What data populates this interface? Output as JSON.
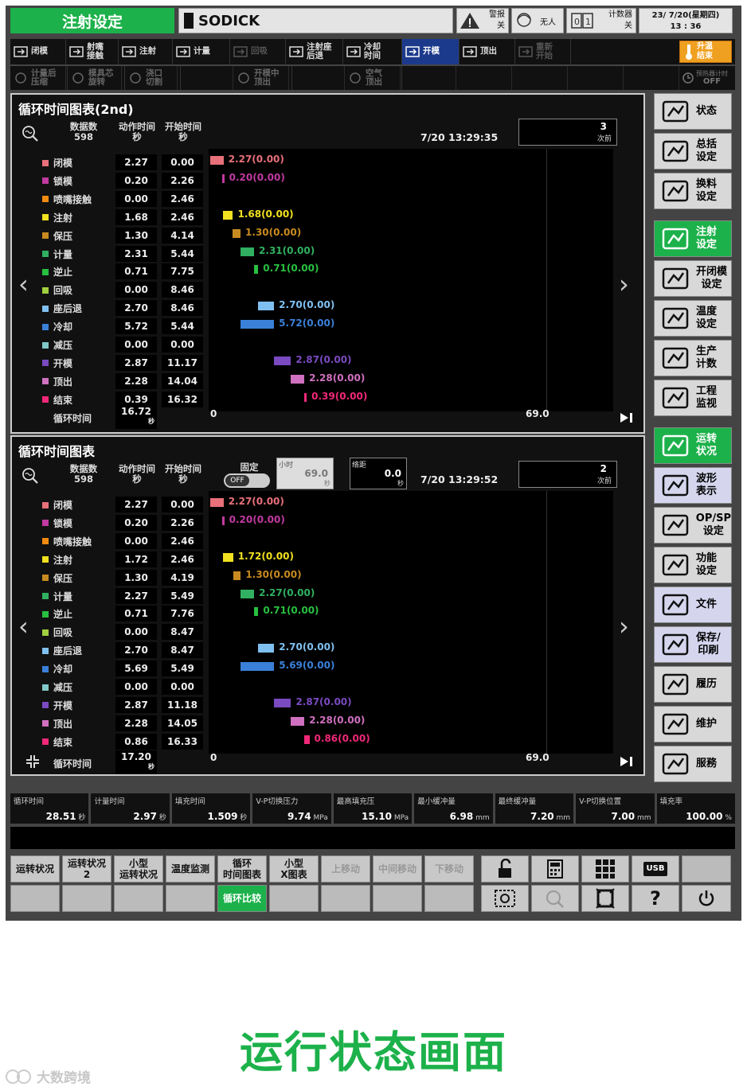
{
  "header": {
    "title": "注射设定",
    "brand": "SODICK",
    "alarm": {
      "l1": "警报",
      "l2": "关"
    },
    "unmanned": "无人",
    "counter": {
      "l1": "计数器",
      "l2": "关"
    },
    "date": "23/ 7/20(星期四)",
    "time": "13 : 36"
  },
  "toolbar1": [
    {
      "label": "闭模",
      "icon": "mold-close-icon",
      "state": "normal"
    },
    {
      "label": "射嘴\n接触",
      "icon": "nozzle-touch-icon",
      "state": "normal"
    },
    {
      "label": "注射",
      "icon": "injection-icon",
      "state": "normal"
    },
    {
      "label": "计量",
      "icon": "metering-icon",
      "state": "normal"
    },
    {
      "label": "回吸",
      "icon": "suckback-icon",
      "state": "dim"
    },
    {
      "label": "注射座\n后退",
      "icon": "carriage-back-icon",
      "state": "normal"
    },
    {
      "label": "冷却\n时间",
      "icon": "cooling-icon",
      "state": "normal"
    },
    {
      "label": "开模",
      "icon": "mold-open-icon",
      "state": "active"
    },
    {
      "label": "顶出",
      "icon": "ejector-icon",
      "state": "normal"
    },
    {
      "label": "重新\n开始",
      "icon": "restart-icon",
      "state": "dim"
    }
  ],
  "heat_button": {
    "l1": "升温",
    "l2": "结束"
  },
  "toolbar2": [
    {
      "label": "计量后\n压缩",
      "icon": "decompress-icon"
    },
    {
      "label": "模具芯\n旋转",
      "icon": "core-rotate-icon"
    },
    {
      "label": "浇口\n切割",
      "icon": "gate-cut-icon"
    },
    {
      "label": "开模中\n顶出",
      "icon": "open-eject-icon"
    },
    {
      "label": "空气\n顶出",
      "icon": "air-eject-icon"
    }
  ],
  "timer_off": {
    "l1": "预热器计时",
    "l2": "OFF"
  },
  "panel1": {
    "title": "循环时间图表(2nd)",
    "count_label": "数据数",
    "count": "598",
    "col1": "动作时间",
    "col2": "开始时间",
    "unit": "秒",
    "timestamp": "7/20 13:29:35",
    "history_num": "3",
    "history_label": "次前",
    "cycle_label": "循环时间",
    "cycle_value": "16.72",
    "axis_start": "0",
    "axis_end": "69.0",
    "rows": [
      {
        "name": "闭模",
        "color": "#e8707a",
        "action": "2.27",
        "start": "0.00",
        "label": "2.27(0.00)"
      },
      {
        "name": "锁模",
        "color": "#c03aa0",
        "action": "0.20",
        "start": "2.26",
        "label": "0.20(0.00)"
      },
      {
        "name": "喷嘴接触",
        "color": "#f08a10",
        "action": "0.00",
        "start": "2.46",
        "label": ""
      },
      {
        "name": "注射",
        "color": "#f0e020",
        "action": "1.68",
        "start": "2.46",
        "label": "1.68(0.00)"
      },
      {
        "name": "保压",
        "color": "#c88a20",
        "action": "1.30",
        "start": "4.14",
        "label": "1.30(0.00)"
      },
      {
        "name": "计量",
        "color": "#30b060",
        "action": "2.31",
        "start": "5.44",
        "label": "2.31(0.00)"
      },
      {
        "name": "逆止",
        "color": "#28c040",
        "action": "0.71",
        "start": "7.75",
        "label": "0.71(0.00)"
      },
      {
        "name": "回吸",
        "color": "#a0d040",
        "action": "0.00",
        "start": "8.46",
        "label": ""
      },
      {
        "name": "座后退",
        "color": "#80c0f0",
        "action": "2.70",
        "start": "8.46",
        "label": "2.70(0.00)"
      },
      {
        "name": "冷却",
        "color": "#3a80d8",
        "action": "5.72",
        "start": "5.44",
        "label": "5.72(0.00)"
      },
      {
        "name": "减压",
        "color": "#80c8c8",
        "action": "0.00",
        "start": "0.00",
        "label": ""
      },
      {
        "name": "开模",
        "color": "#7a4ac0",
        "action": "2.87",
        "start": "11.17",
        "label": "2.87(0.00)"
      },
      {
        "name": "顶出",
        "color": "#d070c0",
        "action": "2.28",
        "start": "14.04",
        "label": "2.28(0.00)"
      },
      {
        "name": "结束",
        "color": "#f02878",
        "action": "0.39",
        "start": "16.32",
        "label": "0.39(0.00)"
      }
    ]
  },
  "panel2": {
    "title": "循环时间图表",
    "count_label": "数据数",
    "count": "598",
    "col1": "动作时间",
    "col2": "开始时间",
    "unit": "秒",
    "fixed_label": "固定",
    "toggle": "OFF",
    "small_label": "小时",
    "small_value": "69.0",
    "pitch_label": "络距",
    "pitch_value": "0.0",
    "timestamp": "7/20 13:29:52",
    "history_num": "2",
    "history_label": "次前",
    "cycle_label": "循环时间",
    "cycle_value": "17.20",
    "axis_start": "0",
    "axis_end": "69.0",
    "rows": [
      {
        "name": "闭模",
        "color": "#e8707a",
        "action": "2.27",
        "start": "0.00",
        "label": "2.27(0.00)"
      },
      {
        "name": "锁模",
        "color": "#c03aa0",
        "action": "0.20",
        "start": "2.26",
        "label": "0.20(0.00)"
      },
      {
        "name": "喷嘴接触",
        "color": "#f08a10",
        "action": "0.00",
        "start": "2.46",
        "label": ""
      },
      {
        "name": "注射",
        "color": "#f0e020",
        "action": "1.72",
        "start": "2.46",
        "label": "1.72(0.00)"
      },
      {
        "name": "保压",
        "color": "#c88a20",
        "action": "1.30",
        "start": "4.19",
        "label": "1.30(0.00)"
      },
      {
        "name": "计量",
        "color": "#30b060",
        "action": "2.27",
        "start": "5.49",
        "label": "2.27(0.00)"
      },
      {
        "name": "逆止",
        "color": "#28c040",
        "action": "0.71",
        "start": "7.76",
        "label": "0.71(0.00)"
      },
      {
        "name": "回吸",
        "color": "#a0d040",
        "action": "0.00",
        "start": "8.47",
        "label": ""
      },
      {
        "name": "座后退",
        "color": "#80c0f0",
        "action": "2.70",
        "start": "8.47",
        "label": "2.70(0.00)"
      },
      {
        "name": "冷却",
        "color": "#3a80d8",
        "action": "5.69",
        "start": "5.49",
        "label": "5.69(0.00)"
      },
      {
        "name": "减压",
        "color": "#80c8c8",
        "action": "0.00",
        "start": "0.00",
        "label": ""
      },
      {
        "name": "开模",
        "color": "#7a4ac0",
        "action": "2.87",
        "start": "11.18",
        "label": "2.87(0.00)"
      },
      {
        "name": "顶出",
        "color": "#d070c0",
        "action": "2.28",
        "start": "14.05",
        "label": "2.28(0.00)"
      },
      {
        "name": "结束",
        "color": "#f02878",
        "action": "0.86",
        "start": "16.33",
        "label": "0.86(0.00)"
      }
    ]
  },
  "sidebar": [
    {
      "label": "状态",
      "icon": "gauge-icon",
      "style": "normal"
    },
    {
      "label": "总括\n设定",
      "icon": "summary-icon",
      "style": "normal"
    },
    {
      "label": "换料\n设定",
      "icon": "material-change-icon",
      "style": "normal"
    },
    {
      "label": "注射\n设定",
      "icon": "injection-setting-icon",
      "style": "green"
    },
    {
      "label": "开闭模\n设定",
      "icon": "mold-setting-icon",
      "style": "normal"
    },
    {
      "label": "温度\n设定",
      "icon": "thermometer-icon",
      "style": "normal"
    },
    {
      "label": "生产\n计数",
      "icon": "production-icon",
      "style": "normal"
    },
    {
      "label": "工程\n监视",
      "icon": "monitor-icon",
      "style": "normal"
    },
    {
      "label": "运转\n状况",
      "icon": "gears-icon",
      "style": "green"
    },
    {
      "label": "波形\n表示",
      "icon": "waveform-icon",
      "style": "lilac"
    },
    {
      "label": "OP/SP\n设定",
      "icon": "opsp-icon",
      "style": "normal"
    },
    {
      "label": "功能\n设定",
      "icon": "list-icon",
      "style": "normal"
    },
    {
      "label": "文件",
      "icon": "files-icon",
      "style": "lilac"
    },
    {
      "label": "保存/\n印刷",
      "icon": "save-print-icon",
      "style": "lilac"
    },
    {
      "label": "履历",
      "icon": "history-icon",
      "style": "normal"
    },
    {
      "label": "维护",
      "icon": "tools-icon",
      "style": "normal"
    },
    {
      "label": "服務",
      "icon": "service-icon",
      "style": "normal"
    }
  ],
  "stats": [
    {
      "label": "循环时间",
      "value": "28.51",
      "unit": "秒"
    },
    {
      "label": "计量时间",
      "value": "2.97",
      "unit": "秒"
    },
    {
      "label": "填充时间",
      "value": "1.509",
      "unit": "秒"
    },
    {
      "label": "V-P切换压力",
      "value": "9.74",
      "unit": "MPa"
    },
    {
      "label": "最高填充压",
      "value": "15.10",
      "unit": "MPa"
    },
    {
      "label": "最小缓冲量",
      "value": "6.98",
      "unit": "mm"
    },
    {
      "label": "最终缓冲量",
      "value": "7.20",
      "unit": "mm"
    },
    {
      "label": "V-P切换位置",
      "value": "7.00",
      "unit": "mm"
    },
    {
      "label": "填充率",
      "value": "100.00",
      "unit": "%"
    }
  ],
  "footer_row1": [
    {
      "label": "运转状况",
      "style": "normal"
    },
    {
      "label": "运转状况\n2",
      "style": "normal"
    },
    {
      "label": "小型\n运转状况",
      "style": "normal"
    },
    {
      "label": "温度监测",
      "style": "normal"
    },
    {
      "label": "循环\n时间图表",
      "style": "normal"
    },
    {
      "label": "小型\nX图表",
      "style": "normal"
    },
    {
      "label": "上移动",
      "style": "dim"
    },
    {
      "label": "中间移动",
      "style": "dim"
    },
    {
      "label": "下移动",
      "style": "dim"
    }
  ],
  "footer_row2": [
    {
      "label": "",
      "style": "empty"
    },
    {
      "label": "",
      "style": "empty"
    },
    {
      "label": "",
      "style": "empty"
    },
    {
      "label": "",
      "style": "empty"
    },
    {
      "label": "循环比较",
      "style": "green"
    },
    {
      "label": "",
      "style": "empty"
    },
    {
      "label": "",
      "style": "empty"
    },
    {
      "label": "",
      "style": "empty"
    },
    {
      "label": "",
      "style": "empty"
    }
  ],
  "icon_buttons": {
    "usb": "USB",
    "help": "?"
  },
  "caption": "运行状态画面",
  "watermark": "大数跨境"
}
